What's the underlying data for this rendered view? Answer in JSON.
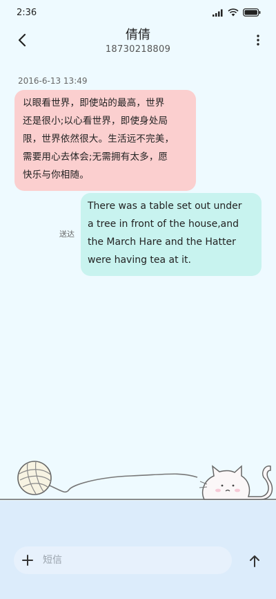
{
  "status_bar": {
    "time": "2:36",
    "icons": [
      "signal-icon",
      "wifi-icon",
      "battery-icon"
    ]
  },
  "header": {
    "contact_name": "倩倩",
    "contact_number": "18730218809",
    "back_icon": "chevron-left-icon",
    "more_icon": "more-vertical-icon"
  },
  "conversation": {
    "timestamp": "2016-6-13 13:49",
    "received_message": {
      "lines": [
        "以眼看世界，即使站的最高，世界",
        "还是很小;以心看世界，即使身处局",
        "限，世界依然很大。生活远不完美，",
        "需要用心去体会;无需拥有太多，愿",
        "快乐与你相随。"
      ]
    },
    "sent_message": {
      "status": "送达",
      "lines": [
        "There was a table set out under",
        "a tree in front of the house,and",
        "the March Hare and the Hatter",
        "were having tea at it."
      ]
    }
  },
  "compose": {
    "placeholder": "短信",
    "add_icon": "plus-icon",
    "send_icon": "arrow-up-icon"
  },
  "colors": {
    "background": "#eefaff",
    "received_bubble": "#fbcfcf",
    "sent_bubble": "#c8f3ef",
    "compose_area": "#dcecfb"
  }
}
